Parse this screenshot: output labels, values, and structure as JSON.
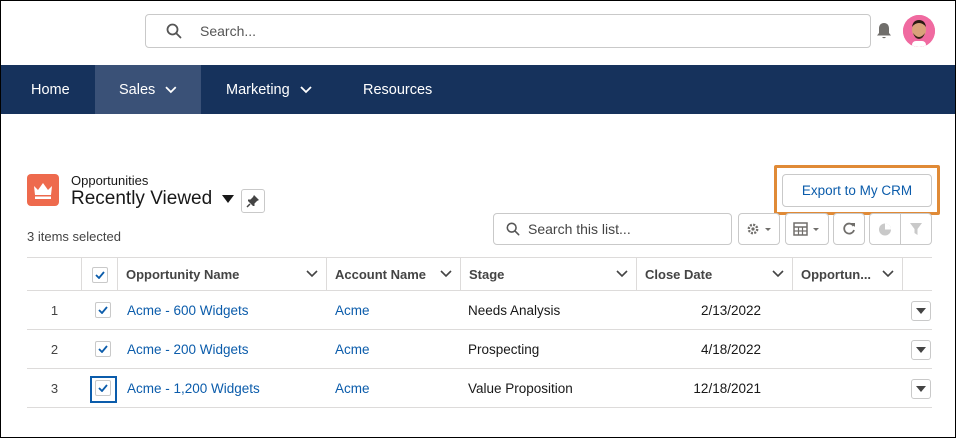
{
  "header": {
    "search_placeholder": "Search..."
  },
  "nav": {
    "items": [
      {
        "label": "Home",
        "has_menu": false,
        "active": false
      },
      {
        "label": "Sales",
        "has_menu": true,
        "active": true
      },
      {
        "label": "Marketing",
        "has_menu": true,
        "active": false
      },
      {
        "label": "Resources",
        "has_menu": false,
        "active": false
      }
    ]
  },
  "list_view": {
    "object_label": "Opportunities",
    "view_name": "Recently Viewed",
    "selected_text": "3 items selected",
    "export_label": "Export to My CRM",
    "search_placeholder": "Search this list..."
  },
  "table": {
    "columns": [
      "Opportunity Name",
      "Account Name",
      "Stage",
      "Close Date",
      "Opportun..."
    ],
    "rows": [
      {
        "num": "1",
        "checked": true,
        "name": "Acme - 600 Widgets",
        "account": "Acme",
        "stage": "Needs Analysis",
        "close_date": "2/13/2022"
      },
      {
        "num": "2",
        "checked": true,
        "name": "Acme - 200 Widgets",
        "account": "Acme",
        "stage": "Prospecting",
        "close_date": "4/18/2022"
      },
      {
        "num": "3",
        "checked": true,
        "name": "Acme - 1,200 Widgets",
        "account": "Acme",
        "stage": "Value Proposition",
        "close_date": "12/18/2021"
      }
    ]
  },
  "colors": {
    "nav_bg": "#16325c",
    "nav_active": "#3a5177",
    "link": "#0b5cab",
    "highlight": "#e08a36",
    "object_icon": "#ee6a4d"
  }
}
